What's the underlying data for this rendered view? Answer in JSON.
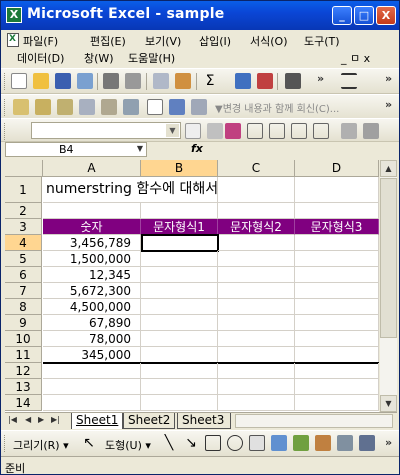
{
  "window": {
    "title": "Microsoft Excel - sample",
    "min_label": "_",
    "max_label": "□",
    "close_label": "X"
  },
  "menu": {
    "row1": [
      "파일(F)",
      "편집(E)",
      "보기(V)",
      "삽입(I)",
      "서식(O)",
      "도구(T)"
    ],
    "row2": [
      "데이터(D)",
      "창(W)",
      "도움말(H)"
    ],
    "doc_controls": "_ ㅁ x"
  },
  "toolbar2": {
    "review_text": "▼변경 내용과 함께 회신(C)..."
  },
  "formula_bar": {
    "name_box": "B4",
    "fx_label": "fx",
    "formula": ""
  },
  "sheet": {
    "columns": [
      "A",
      "B",
      "C",
      "D"
    ],
    "rows": [
      "1",
      "2",
      "3",
      "4",
      "5",
      "6",
      "7",
      "8",
      "9",
      "10",
      "11",
      "12",
      "13",
      "14"
    ],
    "title": "numerstring 함수에 대해서",
    "header": [
      "숫자",
      "문자형식1",
      "문자형식2",
      "문자형식3"
    ],
    "values": [
      "3,456,789",
      "1,500,000",
      "12,345",
      "5,672,300",
      "4,500,000",
      "67,890",
      "78,000",
      "345,000"
    ],
    "header_color": "#800080",
    "selected_cell": "B4"
  },
  "tabs": [
    "Sheet1",
    "Sheet2",
    "Sheet3"
  ],
  "active_tab": "Sheet1",
  "drawing_toolbar": {
    "draw_label": "그리기(R) ▾",
    "autoshape_label": "도형(U) ▾"
  },
  "status": {
    "text": "준비"
  }
}
